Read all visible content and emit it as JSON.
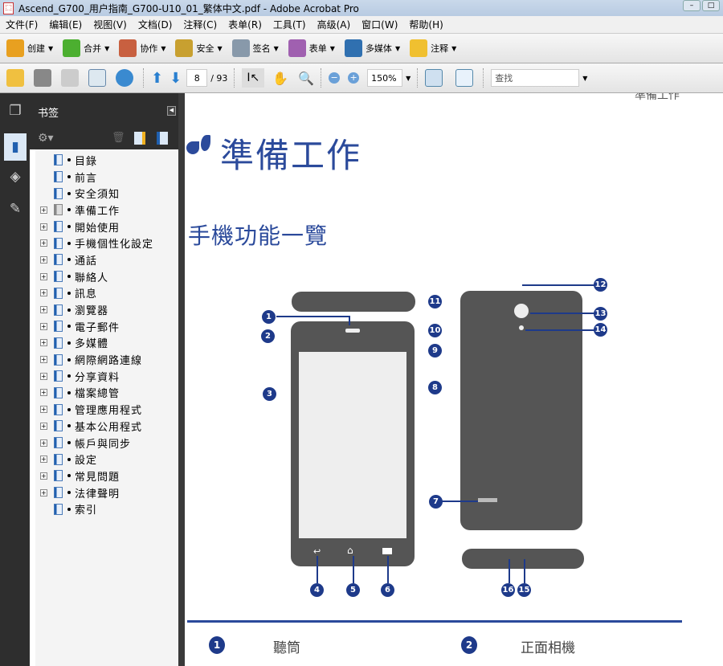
{
  "window": {
    "title": "Ascend_G700_用户指南_G700-U10_01_繁体中文.pdf - Adobe Acrobat Pro"
  },
  "menu": [
    "文件(F)",
    "编辑(E)",
    "视图(V)",
    "文档(D)",
    "注释(C)",
    "表单(R)",
    "工具(T)",
    "高级(A)",
    "窗口(W)",
    "帮助(H)"
  ],
  "toolbar1": [
    "创建",
    "合并",
    "协作",
    "安全",
    "签名",
    "表单",
    "多媒体",
    "注释"
  ],
  "toolbar2": {
    "page": "8",
    "total": "/ 93",
    "zoom": "150%",
    "find_placeholder": "查找"
  },
  "bookmarks": {
    "title": "书签",
    "items": [
      {
        "label": "目錄",
        "exp": false
      },
      {
        "label": "前言",
        "exp": false
      },
      {
        "label": "安全須知",
        "exp": false
      },
      {
        "label": "準備工作",
        "exp": true
      },
      {
        "label": "開始使用",
        "exp": true
      },
      {
        "label": "手機個性化設定",
        "exp": true
      },
      {
        "label": "通話",
        "exp": true
      },
      {
        "label": "聯絡人",
        "exp": true
      },
      {
        "label": "訊息",
        "exp": true
      },
      {
        "label": "瀏覽器",
        "exp": true
      },
      {
        "label": "電子郵件",
        "exp": true
      },
      {
        "label": "多媒體",
        "exp": true
      },
      {
        "label": "網際網路連線",
        "exp": true
      },
      {
        "label": "分享資料",
        "exp": true
      },
      {
        "label": "檔案總管",
        "exp": true
      },
      {
        "label": "管理應用程式",
        "exp": true
      },
      {
        "label": "基本公用程式",
        "exp": true
      },
      {
        "label": "帳戶與同步",
        "exp": true
      },
      {
        "label": "設定",
        "exp": true
      },
      {
        "label": "常見問題",
        "exp": true
      },
      {
        "label": "法律聲明",
        "exp": true
      },
      {
        "label": "索引",
        "exp": false
      }
    ]
  },
  "doc": {
    "running_header": "準備工作",
    "heading": "準備工作",
    "subheading": "手機功能一覽",
    "legend": [
      {
        "num": "1",
        "label": "聽筒"
      },
      {
        "num": "2",
        "label": "正面相機"
      }
    ]
  },
  "callouts": [
    "1",
    "2",
    "3",
    "4",
    "5",
    "6",
    "7",
    "8",
    "9",
    "10",
    "11",
    "12",
    "13",
    "14",
    "15",
    "16"
  ]
}
